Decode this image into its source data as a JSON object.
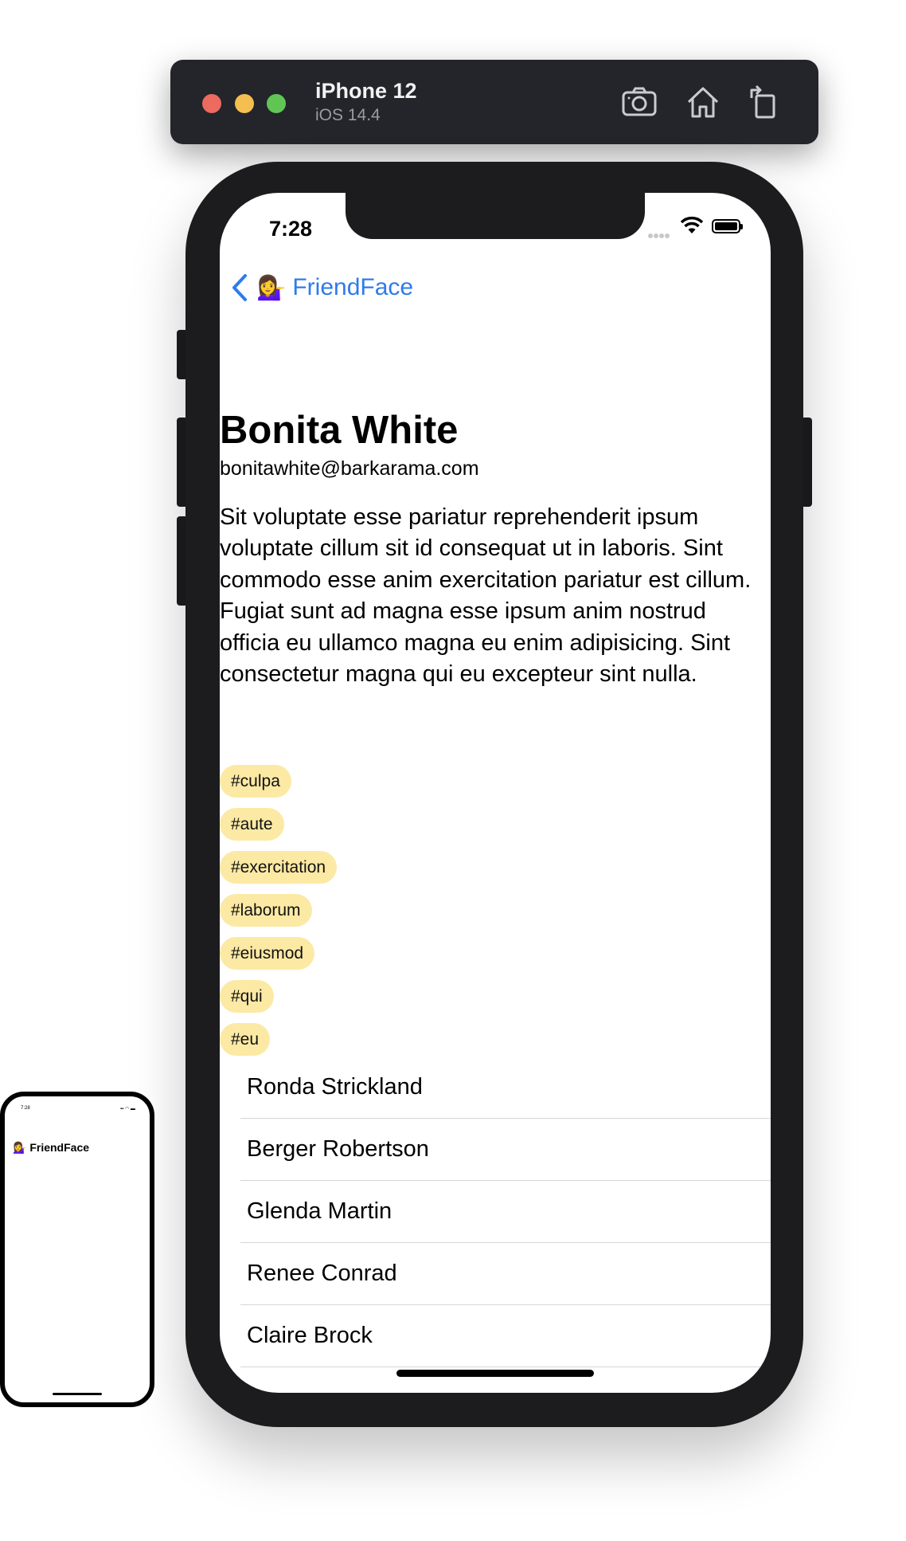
{
  "simulator": {
    "device_name": "iPhone 12",
    "os_version": "iOS 14.4",
    "toolbar_icons": [
      "screenshot-icon",
      "home-icon",
      "rotate-icon"
    ]
  },
  "status_bar": {
    "time": "7:28",
    "icons": [
      "signal-icon",
      "wifi-icon",
      "battery-icon"
    ]
  },
  "nav": {
    "back_emoji": "💁‍♀️",
    "back_label": "FriendFace",
    "accent_color": "#2f7bea"
  },
  "user": {
    "name": "Bonita White",
    "email": "bonitawhite@barkarama.com",
    "about": "Sit voluptate esse pariatur reprehenderit ipsum voluptate cillum sit id consequat ut in laboris. Sint commodo esse anim exercitation pariatur est cillum. Fugiat sunt ad magna esse ipsum anim nostrud officia eu ullamco magna eu enim adipisicing. Sint consectetur magna qui eu excepteur sint nulla.",
    "tags": [
      "#culpa",
      "#aute",
      "#exercitation",
      "#laborum",
      "#eiusmod",
      "#qui",
      "#eu"
    ],
    "tag_color": "#fce9a4"
  },
  "friends": [
    "Ronda Strickland",
    "Berger Robertson",
    "Glenda Martin",
    "Renee Conrad",
    "Claire Brock"
  ],
  "mini_preview": {
    "time": "7:28",
    "title": "💁‍♀️ FriendFace"
  }
}
